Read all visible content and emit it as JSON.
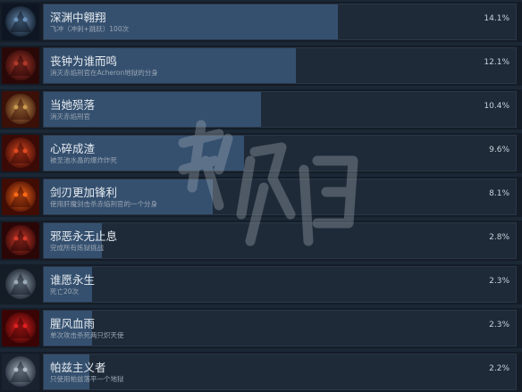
{
  "achievements": [
    {
      "title": "深渊中翱翔",
      "desc": "飞冲（冲刺+跳跃）100次",
      "pct": "14.1%",
      "fill": 0.141,
      "icon": "dark-angel-icon",
      "c1": "#6a90b8",
      "c2": "#0d1622"
    },
    {
      "title": "丧钟为谁而鸣",
      "desc": "消灭赤焰刑官在Acheron地狱的分身",
      "pct": "12.1%",
      "fill": 0.121,
      "icon": "demon-twins-icon",
      "c1": "#b03a2a",
      "c2": "#2a0808"
    },
    {
      "title": "当她殒落",
      "desc": "消灭赤焰刑官",
      "pct": "10.4%",
      "fill": 0.104,
      "icon": "winged-demon-icon",
      "c1": "#c89a50",
      "c2": "#3a1008"
    },
    {
      "title": "心碎成渣",
      "desc": "被圣池水晶的爆炸炸死",
      "pct": "9.6%",
      "fill": 0.096,
      "icon": "shattered-heart-icon",
      "c1": "#e04a20",
      "c2": "#3a0a06"
    },
    {
      "title": "剑刃更加锋利",
      "desc": "使用肝魔剑击杀赤焰刑官的一个分身",
      "pct": "8.1%",
      "fill": 0.081,
      "icon": "sword-icon",
      "c1": "#ff6a18",
      "c2": "#400c04"
    },
    {
      "title": "邪恶永无止息",
      "desc": "完成所有炼狱挑战",
      "pct": "2.8%",
      "fill": 0.028,
      "icon": "skull-icon",
      "c1": "#d23a2a",
      "c2": "#2a0606"
    },
    {
      "title": "谁愿永生",
      "desc": "死亡20次",
      "pct": "2.3%",
      "fill": 0.023,
      "icon": "horned-skull-icon",
      "c1": "#9aa8b8",
      "c2": "#141c26"
    },
    {
      "title": "腥风血雨",
      "desc": "单次攻击杀死两只炽天使",
      "pct": "2.3%",
      "fill": 0.023,
      "icon": "blood-rain-icon",
      "c1": "#e02020",
      "c2": "#3a0404"
    },
    {
      "title": "帕兹主义者",
      "desc": "只使用帕兹落平一个地狱",
      "pct": "2.2%",
      "fill": 0.022,
      "icon": "pazuzu-head-icon",
      "c1": "#b0bcc8",
      "c2": "#1a2230"
    }
  ]
}
